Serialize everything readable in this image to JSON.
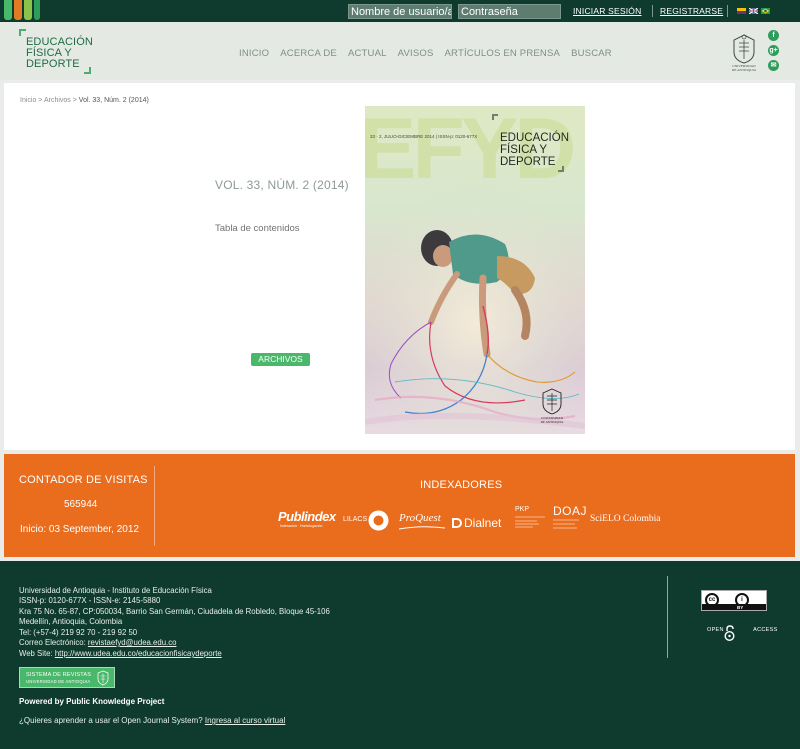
{
  "topbar": {
    "username_placeholder": "Nombre de usuario/a",
    "password_placeholder": "Contraseña",
    "login_label": "INICIAR SESIÓN",
    "register_label": "REGISTRARSE",
    "languages": [
      "es",
      "en",
      "pt"
    ]
  },
  "header": {
    "brand_line1": "EDUCACIÓN",
    "brand_line2": "FÍSICA Y",
    "brand_line3": "DEPORTE",
    "nav": [
      "INICIO",
      "ACERCA DE",
      "ACTUAL",
      "AVISOS",
      "ARTÍCULOS EN PRENSA",
      "BUSCAR"
    ],
    "seal_name": "UNIVERSIDAD DE ANTIOQUIA",
    "social": [
      "facebook-icon",
      "google-plus-icon",
      "email-icon"
    ]
  },
  "main": {
    "breadcrumb_home": "Inicio",
    "breadcrumb_archive": "Archivos",
    "breadcrumb_current": "Vol. 33, Núm. 2 (2014)",
    "issue_title": "VOL. 33, NÚM. 2 (2014)",
    "toc_link": "Tabla de contenidos",
    "archive_button": "ARCHIVOS",
    "cover": {
      "watermark": "EFYD",
      "issn_line": "33 · 2, JULIO-DICIEMBRE 2014 | ISSN-p: 0120-677X",
      "title_line1": "EDUCACIÓN",
      "title_line2": "FÍSICA Y",
      "title_line3": "DEPORTE",
      "seal_text": "UNIVERSIDAD DE ANTIOQUIA"
    }
  },
  "visits": {
    "title": "CONTADOR DE VISITAS",
    "count": "565944",
    "start": "Inicio: 03 September, 2012"
  },
  "indexers": {
    "title": "INDEXADORES",
    "items": [
      "Publindex",
      "LILACS",
      "ProQuest",
      "Dialnet",
      "PKP",
      "DOAJ",
      "SciELO Colombia"
    ],
    "publindex_sub": "Indexación · Homologación"
  },
  "footer": {
    "line1": "Universidad de Antioquia - Instituto de Educación Física",
    "line2": "ISSN-p: 0120-677X - ISSN-e: 2145-5880",
    "line3": "Kra 75 No. 65-87, CP:050034, Barrio San Germán, Ciudadela de Robledo, Bloque 45-106",
    "line4": "Medellín, Antioquia, Colombia",
    "line5": "Tel: (+57-4) 219 92 70 - 219 92 50",
    "email_label": "Correo Electrónico: ",
    "email": "revistaefyd@udea.edu.co",
    "website_label": "Web Site: ",
    "website": "http://www.udea.edu.co/educacionfisicaydeporte",
    "cc_label": "BY",
    "open_access_left": "OPEN",
    "open_access_right": "ACCESS",
    "sistema_line1": "SISTEMA DE REVISTAS",
    "sistema_line2": "UNIVERSIDAD DE ANTIOQUIA",
    "powered": "Powered by Public Knowledge Project",
    "learn_text": "¿Quieres aprender a usar el Open Journal System? ",
    "learn_link": "Ingresa al curso virtual"
  },
  "colors": {
    "dark_green": "#0f3b2e",
    "accent_green": "#49b86b",
    "orange": "#ea6c1d"
  }
}
